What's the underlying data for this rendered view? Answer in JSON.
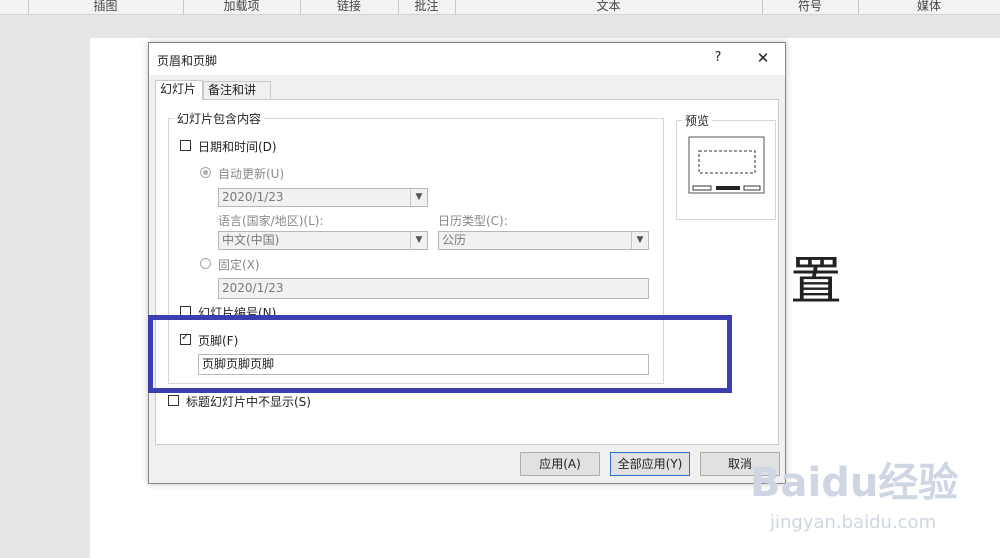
{
  "ribbon": {
    "groups": [
      "插图",
      "加载项",
      "链接",
      "批注",
      "文本",
      "符号",
      "媒体"
    ]
  },
  "slide": {
    "partial_text": "置"
  },
  "dialog": {
    "title": "页眉和页脚",
    "help": "?",
    "close": "✕",
    "tabs": [
      "幻灯片",
      "备注和讲义"
    ],
    "group_title": "幻灯片包含内容",
    "date_time": {
      "label": "日期和时间(D)",
      "checked": false,
      "auto_update": {
        "label": "自动更新(U)",
        "selected": true,
        "value": "2020/1/23"
      },
      "language": {
        "label": "语言(国家/地区)(L):",
        "value": "中文(中国)"
      },
      "calendar": {
        "label": "日历类型(C):",
        "value": "公历"
      },
      "fixed": {
        "label": "固定(X)",
        "selected": false,
        "value": "2020/1/23"
      }
    },
    "slide_number": {
      "label": "幻灯片编号(N)",
      "checked": false
    },
    "footer": {
      "label": "页脚(F)",
      "checked": true,
      "value": "页脚页脚页脚"
    },
    "hide_on_title": {
      "label": "标题幻灯片中不显示(S)",
      "checked": false
    },
    "preview": {
      "label": "预览"
    },
    "buttons": {
      "apply": "应用(A)",
      "apply_all": "全部应用(Y)",
      "cancel": "取消"
    }
  },
  "watermark": {
    "brand": "Baidu经验",
    "url": "jingyan.baidu.com"
  }
}
